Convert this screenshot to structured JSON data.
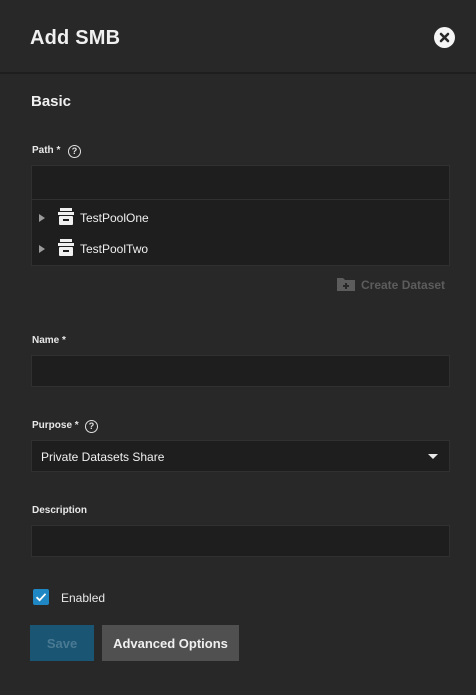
{
  "dialog": {
    "title": "Add SMB",
    "close_icon": "close-circle-icon"
  },
  "basic": {
    "section_title": "Basic"
  },
  "path": {
    "label": "Path *",
    "help_glyph": "?",
    "value": "",
    "tree": [
      {
        "label": "TestPoolOne",
        "icon": "pool-icon",
        "expand_icon": "caret-right-icon"
      },
      {
        "label": "TestPoolTwo",
        "icon": "pool-icon",
        "expand_icon": "caret-right-icon"
      }
    ],
    "create_dataset_label": "Create Dataset",
    "create_dataset_icon": "folder-plus-icon"
  },
  "name": {
    "label": "Name *",
    "value": ""
  },
  "purpose": {
    "label": "Purpose *",
    "help_glyph": "?",
    "selected": "Private Datasets Share"
  },
  "description": {
    "label": "Description",
    "value": ""
  },
  "enabled": {
    "label": "Enabled",
    "checked": true
  },
  "actions": {
    "save_label": "Save",
    "advanced_label": "Advanced Options"
  },
  "colors": {
    "background": "#282828",
    "input_background": "#1e1e1e",
    "accent": "#1f88c4",
    "save_disabled": "#1a5573",
    "secondary_button": "#505050"
  }
}
